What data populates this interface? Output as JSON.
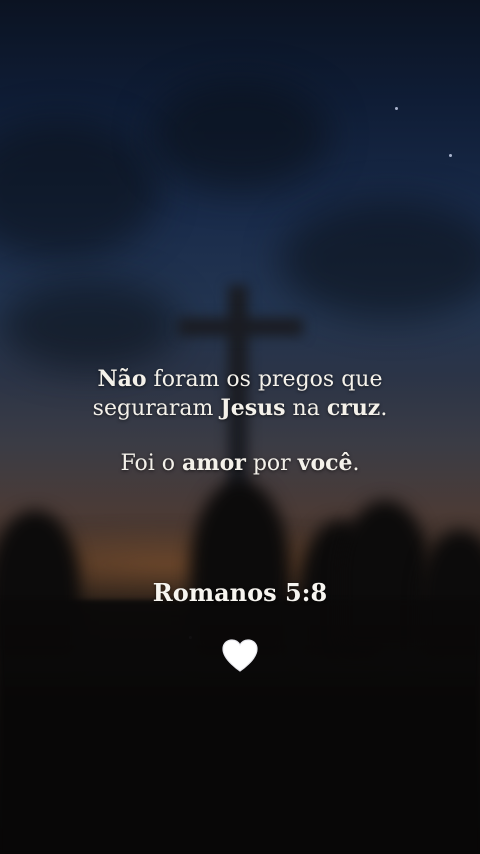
{
  "verse": {
    "line1": [
      {
        "text": "Não",
        "bold": true
      },
      {
        "text": " foram os pregos que",
        "bold": false
      }
    ],
    "line2": [
      {
        "text": "seguraram ",
        "bold": false
      },
      {
        "text": "Jesus",
        "bold": true
      },
      {
        "text": " na ",
        "bold": false
      },
      {
        "text": "cruz",
        "bold": true
      },
      {
        "text": ".",
        "bold": false
      }
    ],
    "line3": [
      {
        "text": "Foi o ",
        "bold": false
      },
      {
        "text": "amor",
        "bold": true
      },
      {
        "text": " por ",
        "bold": false
      },
      {
        "text": "você",
        "bold": true
      },
      {
        "text": ".",
        "bold": false
      }
    ]
  },
  "reference": "Romanos 5:8",
  "heart_icon": "white-heart-icon",
  "colors": {
    "text": "#f4f1ea",
    "heart": "#ffffff"
  }
}
